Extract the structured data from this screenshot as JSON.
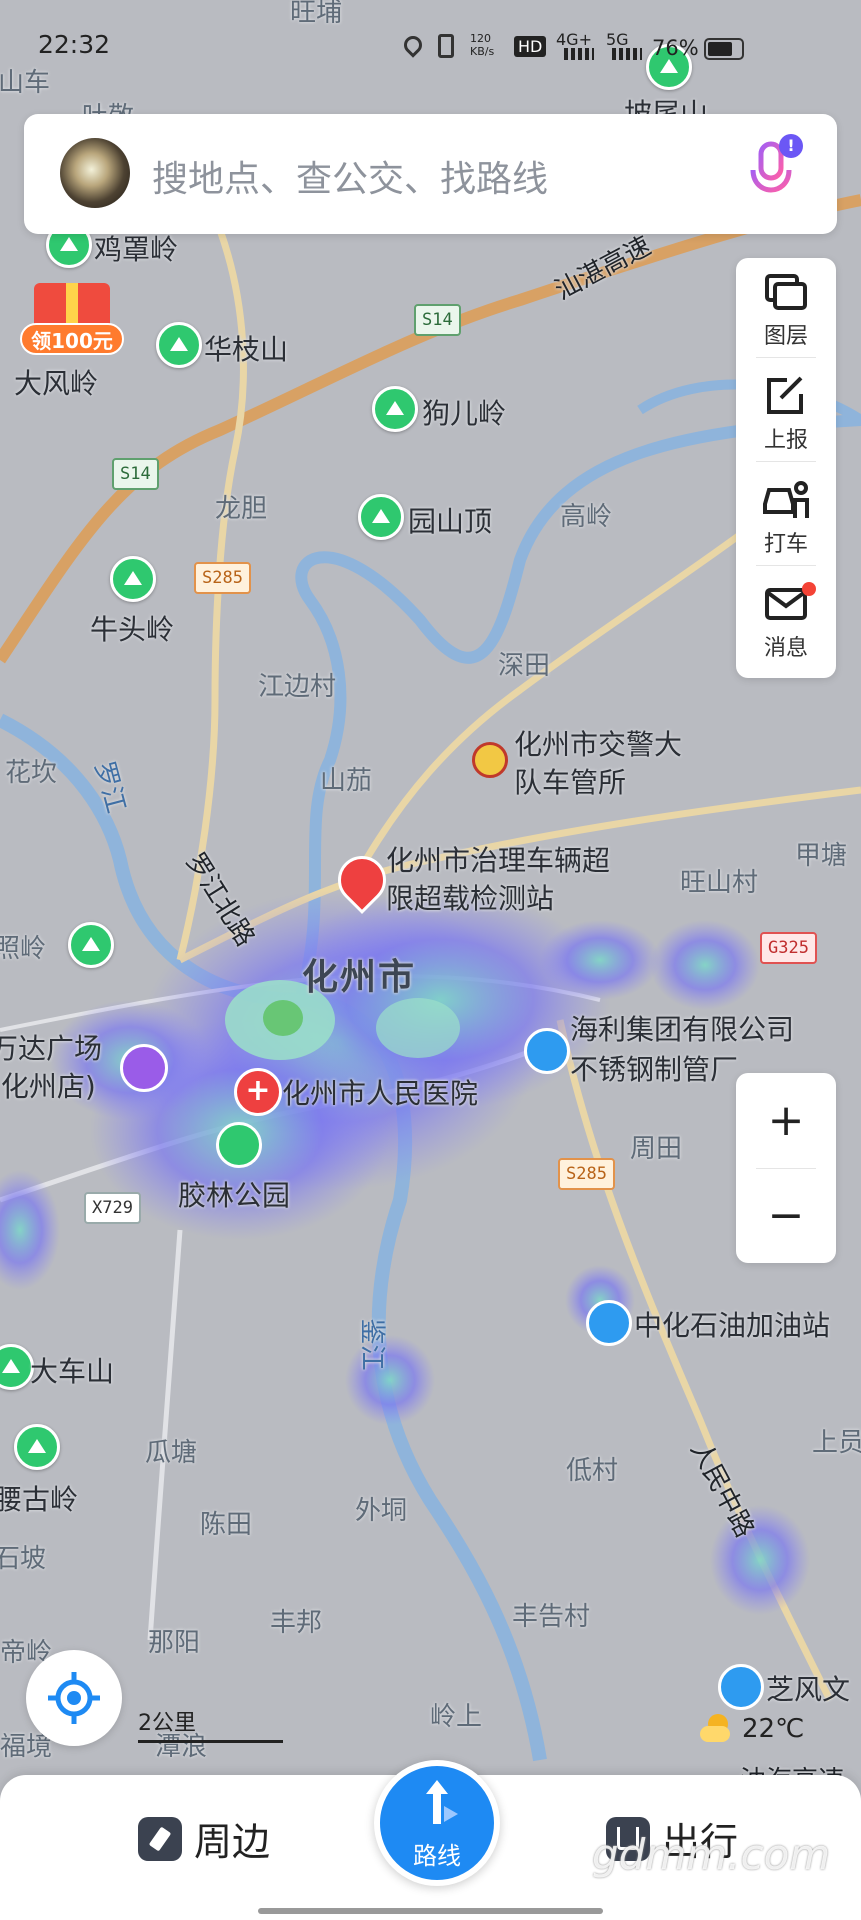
{
  "status_bar": {
    "time": "22:32",
    "net_speed": "120 KB/s",
    "hd": "HD",
    "net1": "4G+",
    "net2": "5G",
    "battery": "76%"
  },
  "search": {
    "placeholder": "搜地点、查公交、找路线"
  },
  "gift": {
    "label": "领100元"
  },
  "toolbar": [
    {
      "label": "图层",
      "icon": "layers-icon"
    },
    {
      "label": "上报",
      "icon": "report-edit-icon"
    },
    {
      "label": "打车",
      "icon": "taxi-icon"
    },
    {
      "label": "消息",
      "icon": "mail-icon"
    }
  ],
  "zoom": {
    "in": "+",
    "out": "−"
  },
  "scale": "2公里",
  "weather": {
    "temp": "22℃",
    "icon": "partly-cloudy-icon"
  },
  "bottom_nav": {
    "nearby": "周边",
    "route": "路线",
    "travel": "出行"
  },
  "watermark": "gdmm.com",
  "map": {
    "city": "化州市",
    "peaks": [
      "鸡罩岭",
      "华枝山",
      "大风岭",
      "狗儿岭",
      "园山顶",
      "牛头岭",
      "大车山",
      "腰古岭",
      "坡尾山"
    ],
    "places": [
      "旺埔",
      "山车",
      "吐敬",
      "龙胆",
      "高岭",
      "深田",
      "江边村",
      "山茄",
      "花坎",
      "旺山村",
      "甲塘",
      "周田",
      "瓜塘",
      "陈田",
      "外垌",
      "低村",
      "丰邦",
      "那阳",
      "丰告村",
      "岭上",
      "福境",
      "潭浪",
      "上员",
      "石坡",
      "帝岭",
      "照岭"
    ],
    "pois": [
      "化州市交警大队车管所",
      "化州市治理车辆超限超载检测站",
      "万达广场(化州店)",
      "化州市人民医院",
      "胶林公园",
      "海利集团有限公司不锈钢制管厂",
      "中化石油加油站",
      "芝风文"
    ],
    "roads": [
      "汕湛高速",
      "罗江北路",
      "人民中路",
      "油海高速"
    ],
    "rivers": [
      "罗江",
      "鉴江"
    ],
    "shields": [
      "S14",
      "S14",
      "S285",
      "S285",
      "G325",
      "X729"
    ]
  }
}
